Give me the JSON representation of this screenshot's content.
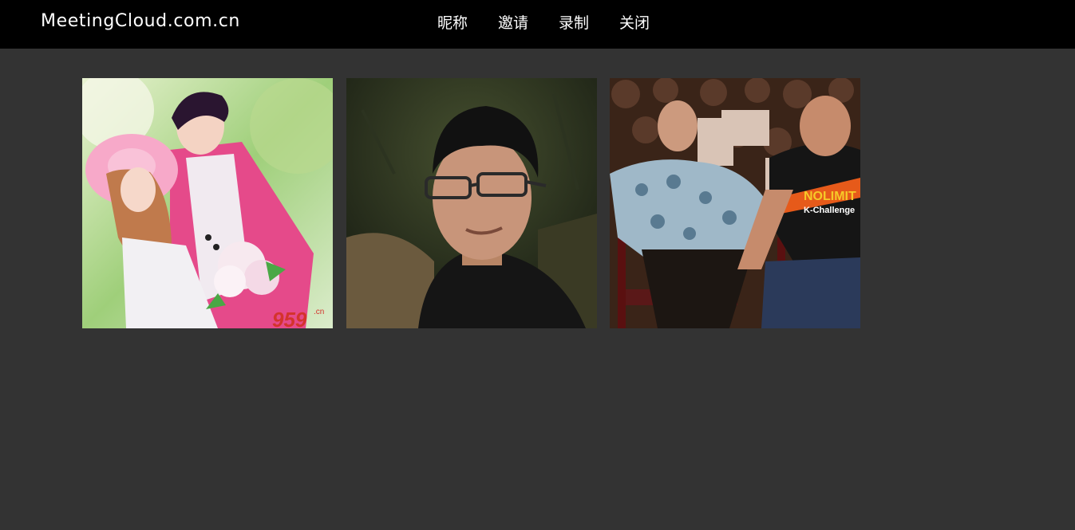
{
  "header": {
    "brand": "MeetingCloud.com.cn",
    "nav": [
      {
        "label": "昵称"
      },
      {
        "label": "邀请"
      },
      {
        "label": "录制"
      },
      {
        "label": "关闭"
      }
    ]
  },
  "videos": [
    {
      "overlay_text": "959",
      "overlay_sub": ".cn"
    },
    {
      "overlay_text": ""
    },
    {
      "shirt_text_1": "NOLIMIT",
      "shirt_text_2": "K-Challenge"
    }
  ],
  "colors": {
    "topbar": "#000000",
    "background": "#333333",
    "text": "#ffffff"
  }
}
